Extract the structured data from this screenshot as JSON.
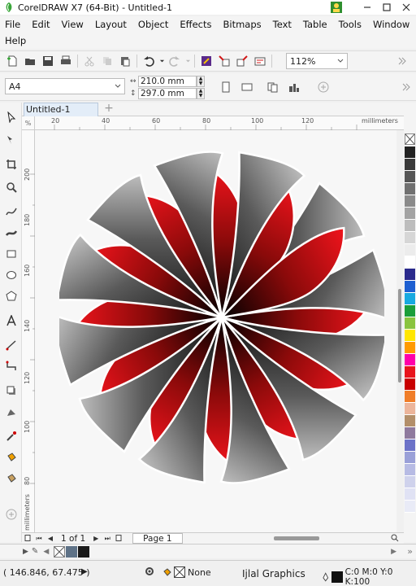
{
  "window": {
    "title": "CorelDRAW X7 (64-Bit) - Untitled-1"
  },
  "menu": {
    "items": [
      "File",
      "Edit",
      "View",
      "Layout",
      "Object",
      "Effects",
      "Bitmaps",
      "Text",
      "Table",
      "Tools",
      "Window"
    ],
    "help": "Help"
  },
  "toolbar": {
    "zoom": "112%"
  },
  "property_bar": {
    "page_size": "A4",
    "width": "210.0 mm",
    "height": "297.0 mm"
  },
  "document": {
    "tab": "Untitled-1"
  },
  "ruler": {
    "unit": "millimeters",
    "h_ticks": [
      "20",
      "40",
      "60",
      "80",
      "100",
      "120"
    ],
    "v_ticks": [
      "200",
      "180",
      "160",
      "140",
      "120",
      "100",
      "80"
    ],
    "corner": "%"
  },
  "page_nav": {
    "counter": "1 of 1",
    "page_tab": "Page 1"
  },
  "status": {
    "coordinates": "( 146.846, 67.475 )",
    "fill": "None",
    "document_info": "Ijlal Graphics",
    "color_info": "C:0 M:0 Y:0 K:100"
  },
  "colors": {
    "accent": "#1e6fc7",
    "petal_red": "#e8141c",
    "petal_gray": "#6e6e6e"
  },
  "palette": [
    "#222222",
    "#3a3a3a",
    "#555555",
    "#707070",
    "#8a8a8a",
    "#a3a3a3",
    "#bdbdbd",
    "#d6d6d6",
    "#ececec",
    "#ffffff",
    "#2a2a8c",
    "#1d5fd1",
    "#18a9e0",
    "#1a9e3a",
    "#8ac43f",
    "#ffe600",
    "#ff9a00",
    "#ff00aa",
    "#e8141c",
    "#c80000",
    "#f07d28",
    "#ecb59b",
    "#b38f6a",
    "#8f7a9e",
    "#6c72c8",
    "#9aa0d8",
    "#b7bbe4",
    "#cfd2ec",
    "#e0e2f4",
    "#e9ebf7"
  ]
}
